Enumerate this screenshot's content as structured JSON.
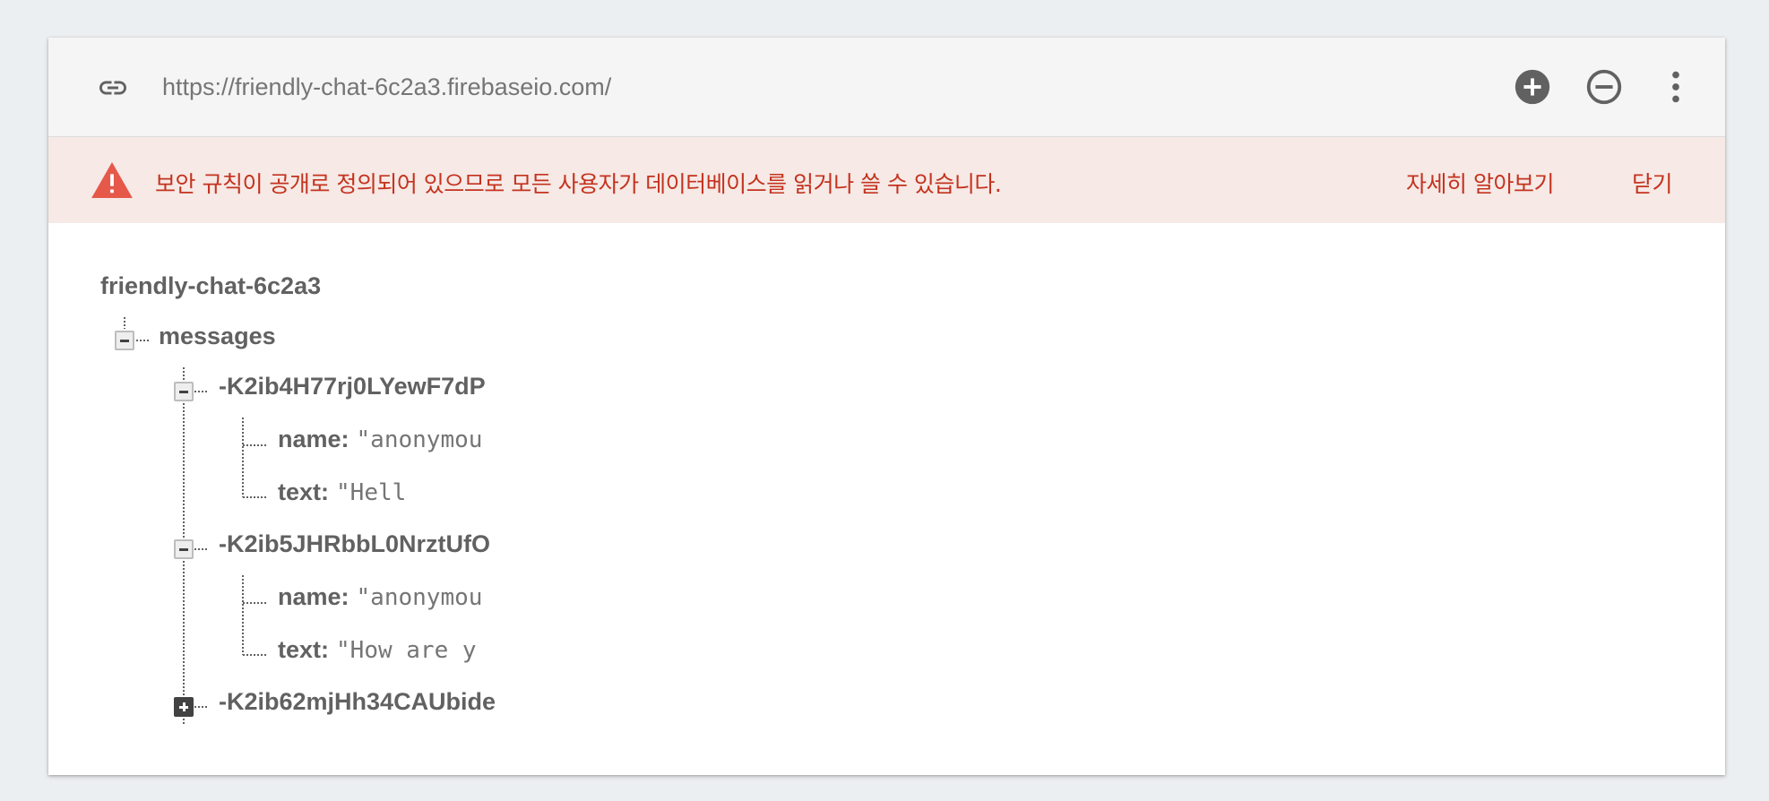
{
  "toolbar": {
    "url": "https://friendly-chat-6c2a3.firebaseio.com/",
    "icons": [
      "link-icon",
      "add-circle-icon",
      "remove-circle-icon",
      "more-vert-icon"
    ]
  },
  "banner": {
    "message": "보안 규칙이 공개로 정의되어 있으므로 모든 사용자가 데이터베이스를 읽거나 쓸 수 있습니다.",
    "learn_more": "자세히 알아보기",
    "close": "닫기",
    "color": "#c4331e",
    "icon": "warning-icon"
  },
  "tree": {
    "root": "friendly-chat-6c2a3",
    "messages": {
      "label": "messages",
      "items": [
        {
          "key": "-K2ib4H77rj0LYewF7dP",
          "expanded": true,
          "fields": [
            {
              "key": "name:",
              "value": "\"anonymou"
            },
            {
              "key": "text:",
              "value": "\"Hell"
            }
          ]
        },
        {
          "key": "-K2ib5JHRbbL0NrztUfO",
          "expanded": true,
          "fields": [
            {
              "key": "name:",
              "value": "\"anonymou"
            },
            {
              "key": "text:",
              "value": "\"How are y"
            }
          ]
        },
        {
          "key": "-K2ib62mjHh34CAUbide",
          "expanded": false,
          "fields": []
        }
      ]
    }
  }
}
